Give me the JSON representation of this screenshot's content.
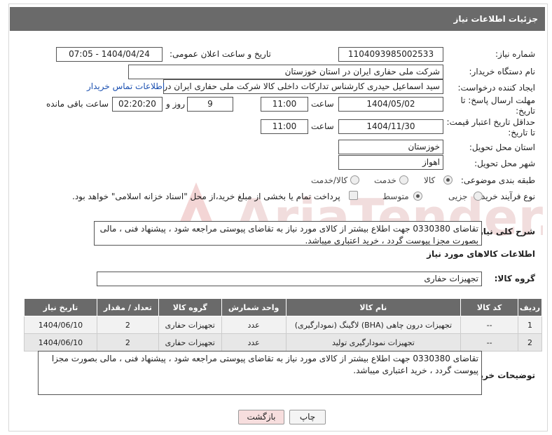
{
  "title": "جزئیات اطلاعات نیاز",
  "fields": {
    "need_number_label": "شماره نیاز:",
    "need_number": "1104093985002533",
    "announce_label": "تاریخ و ساعت اعلان عمومی:",
    "announce_value": "1404/04/24 - 07:05",
    "buyer_org_label": "نام دستگاه خریدار:",
    "buyer_org": "شرکت ملی حفاری ایران در استان خوزستان",
    "requester_label": "ایجاد کننده درخواست:",
    "requester": "سید اسماعیل حیدری کارشناس تدارکات داخلی کالا شرکت ملی حفاری ایران در",
    "contact_link": "اطلاعات تماس خریدار",
    "deadline_label_1": "مهلت ارسال پاسخ: تا",
    "deadline_label_2": "تاریخ:",
    "deadline_date": "1404/05/02",
    "hour_word": "ساعت",
    "deadline_time": "11:00",
    "days_value": "9",
    "days_word": "روز و",
    "remaining_time": "02:20:20",
    "remaining_word": "ساعت باقی مانده",
    "price_label_1": "حداقل تاریخ اعتبار قیمت:",
    "price_label_2": "تا تاریخ:",
    "price_date": "1404/11/30",
    "price_time": "11:00",
    "province_label": "استان محل تحویل:",
    "province": "خوزستان",
    "city_label": "شهر محل تحویل:",
    "city": "اهواز",
    "category_label": "طبقه بندی موضوعی:",
    "category_options": [
      "کالا",
      "خدمت",
      "کالا/خدمت"
    ],
    "process_label": "نوع فرآیند خرید :",
    "process_options": [
      "جزیی",
      "متوسط"
    ],
    "payment_note": "پرداخت تمام یا بخشی از مبلغ خرید،از محل \"اسناد خزانه اسلامی\" خواهد بود.",
    "general_desc_label": "شرح کلی نیاز:",
    "general_desc": "تقاضای 0330380 جهت اطلاع بیشتر از کالای مورد نیاز به تقاضای پیوستی مراجعه شود ، پیشنهاد فنی ، مالی بصورت مجزا پیوست گردد ، خرید اعتباری میباشد.",
    "items_heading": "اطلاعات کالاهای مورد نیاز",
    "goods_group_label": "گروه کالا:",
    "goods_group": "تجهیزات حفاری"
  },
  "table": {
    "headers": [
      "ردیف",
      "کد کالا",
      "نام کالا",
      "واحد شمارش",
      "گروه کالا",
      "تعداد / مقدار",
      "تاریخ نیاز"
    ],
    "rows": [
      [
        "1",
        "--",
        "تجهیزات درون چاهی (BHA) لاگینگ (نمودارگیری)",
        "عدد",
        "تجهیزات حفاری",
        "2",
        "1404/06/10"
      ],
      [
        "2",
        "--",
        "تجهیزات نمودارگیری تولید",
        "عدد",
        "تجهیزات حفاری",
        "2",
        "1404/06/10"
      ]
    ]
  },
  "buyer_notes_label": "توضیحات خریدار:",
  "buyer_notes": "تقاضای 0330380 جهت اطلاع بیشتر از کالای مورد نیاز به تقاضای پیوستی مراجعه شود ، پیشنهاد فنی ، مالی بصورت مجزا پیوست گردد ، خرید اعتباری میباشد.",
  "buttons": {
    "print": "چاپ",
    "back": "بازگشت"
  },
  "watermark_text": "AriaTender.neT",
  "colors": {
    "title_bar": "#6a6a6a",
    "link": "#1a4fb0",
    "back_button": "#f7dede",
    "watermark": "#e9c9c9"
  }
}
